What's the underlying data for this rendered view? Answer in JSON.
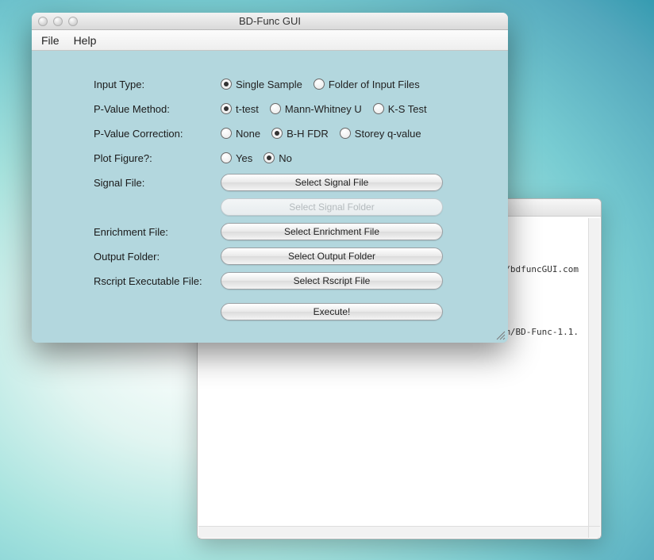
{
  "back_window": {
    "line1": "n/bdfuncGUI.com",
    "line2": "m/BD-Func-1.1."
  },
  "window": {
    "title": "BD-Func GUI",
    "menu": {
      "file": "File",
      "help": "Help"
    }
  },
  "form": {
    "input_type": {
      "label": "Input Type:",
      "options": {
        "single": "Single Sample",
        "folder": "Folder of Input Files"
      },
      "selected": "single"
    },
    "pvalue_method": {
      "label": "P-Value Method:",
      "options": {
        "ttest": "t-test",
        "mw": "Mann-Whitney U",
        "ks": "K-S Test"
      },
      "selected": "ttest"
    },
    "pvalue_correction": {
      "label": "P-Value Correction:",
      "options": {
        "none": "None",
        "bh": "B-H FDR",
        "storey": "Storey q-value"
      },
      "selected": "bh"
    },
    "plot_figure": {
      "label": "Plot Figure?:",
      "options": {
        "yes": "Yes",
        "no": "No"
      },
      "selected": "no"
    },
    "signal_file": {
      "label": "Signal File:",
      "button": "Select Signal File"
    },
    "signal_folder": {
      "label": "",
      "button": "Select Signal Folder"
    },
    "enrichment_file": {
      "label": "Enrichment File:",
      "button": "Select Enrichment File"
    },
    "output_folder": {
      "label": "Output Folder:",
      "button": "Select Output Folder"
    },
    "rscript": {
      "label": "Rscript Executable File:",
      "button": "Select Rscript File"
    },
    "execute": {
      "button": "Execute!"
    }
  }
}
